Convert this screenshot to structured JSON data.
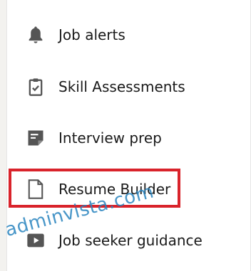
{
  "menu": {
    "items": [
      {
        "label": "Job alerts",
        "icon": "bell-icon"
      },
      {
        "label": "Skill Assessments",
        "icon": "clipboard-check-icon"
      },
      {
        "label": "Interview prep",
        "icon": "note-icon"
      },
      {
        "label": "Resume Builder",
        "icon": "document-icon"
      },
      {
        "label": "Job seeker guidance",
        "icon": "video-play-icon"
      }
    ]
  },
  "highlight": {
    "color": "#d9232b"
  },
  "watermark": {
    "text": "adminvista.com"
  },
  "colors": {
    "icon": "#555555",
    "text": "#1a1a1a",
    "background": "#ffffff",
    "page": "#f3f2ef"
  }
}
